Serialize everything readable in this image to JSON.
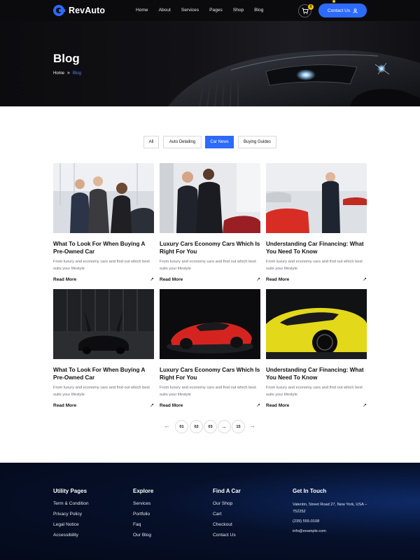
{
  "brand": {
    "name": "RevAuto",
    "accent": "#2d6bff"
  },
  "nav": {
    "items": [
      "Home",
      "About",
      "Services",
      "Pages",
      "Shop",
      "Blog"
    ]
  },
  "cart": {
    "count": "0",
    "icon": "cart-icon"
  },
  "header": {
    "contact_label": "Contact Us"
  },
  "hero": {
    "title": "Blog",
    "breadcrumb": [
      "Home",
      "Blog"
    ]
  },
  "filters": {
    "items": [
      "All",
      "Auto Detailing",
      "Car News",
      "Buying Guides"
    ],
    "active": "Car News"
  },
  "posts": [
    {
      "title": "What To Look For When Buying A Pre-Owned Car",
      "excerpt": "From luxury and economy cars and find out which best suits your lifestyle",
      "read_more": "Read More"
    },
    {
      "title": "Luxury Cars Economy Cars Which Is Right For You",
      "excerpt": "From luxury and economy cars and find out which best suits your lifestyle",
      "read_more": "Read More"
    },
    {
      "title": "Understanding Car Financing: What You Need To Know",
      "excerpt": "From luxury and economy cars and find out which best suits your lifestyle",
      "read_more": "Read More"
    },
    {
      "title": "What To Look For When Buying A Pre-Owned Car",
      "excerpt": "From luxury and economy cars and find out which best suits your lifestyle",
      "read_more": "Read More"
    },
    {
      "title": "Luxury Cars Economy Cars Which Is Right For You",
      "excerpt": "From luxury and economy cars and find out which best suits your lifestyle",
      "read_more": "Read More"
    },
    {
      "title": "Understanding Car Financing: What You Need To Know",
      "excerpt": "From luxury and economy cars and find out which best suits your lifestyle",
      "read_more": "Read More"
    }
  ],
  "pagination": {
    "pages": [
      "01",
      "02",
      "03",
      "...",
      "15"
    ],
    "prev": "←",
    "next": "→"
  },
  "footer": {
    "col1": {
      "title": "Utility Pages",
      "links": [
        "Term & Condition",
        "Privacy Policy",
        "Legal Notice",
        "Accessibility"
      ]
    },
    "col2": {
      "title": "Explore",
      "links": [
        "Services",
        "Portfolio",
        "Faq",
        "Our Blog"
      ]
    },
    "col3": {
      "title": "Find A Car",
      "links": [
        "Our Shop",
        "Cart",
        "Checkout",
        "Contact Us"
      ]
    },
    "col4": {
      "title": "Get In Touch",
      "address": "Valentin, Street Road 27, New York, USA – 752252",
      "phone": "(239) 555-0108",
      "email": "info@example.com"
    }
  }
}
